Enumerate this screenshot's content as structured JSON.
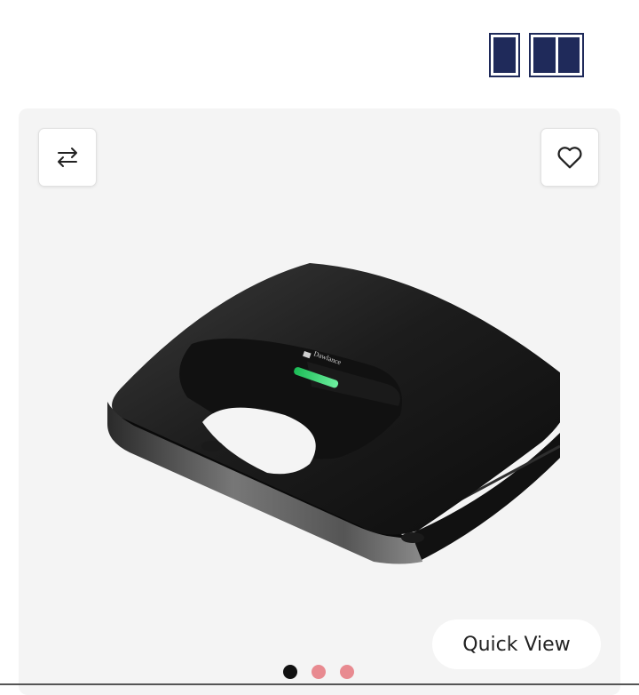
{
  "layout_toggle": {
    "options": [
      {
        "icon": "single-column-icon"
      },
      {
        "icon": "two-column-icon"
      }
    ]
  },
  "product_card": {
    "compare_icon": "swap-arrows-icon",
    "wishlist_icon": "heart-outline-icon",
    "image": {
      "subject": "black sandwich maker",
      "brand_mark": "Dawlance"
    },
    "quick_view_label": "Quick View",
    "carousel": {
      "total": 3,
      "active_index": 0
    },
    "colors": {
      "active_dot": "#111111",
      "inactive_dot": "#e88a90",
      "card_bg": "#f4f4f4",
      "toggle": "#1f2a5a"
    }
  }
}
